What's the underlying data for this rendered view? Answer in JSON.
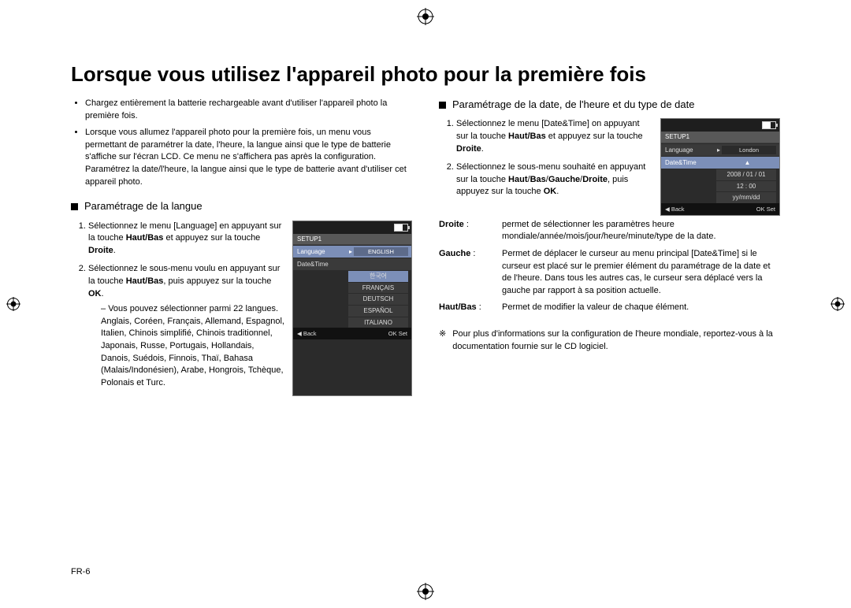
{
  "title": "Lorsque vous utilisez l'appareil photo pour la première fois",
  "col1": {
    "bullets": [
      "Chargez entièrement la batterie rechargeable avant d'utiliser l'appareil photo la première fois.",
      "Lorsque vous allumez l'appareil photo pour la première fois, un menu vous permettant de paramétrer la date, l'heure, la langue ainsi que le type de batterie s'affiche sur l'écran LCD. Ce menu ne s'affichera pas après la configuration. Paramétrez la date/l'heure, la langue ainsi que le type de batterie avant d'utiliser cet appareil photo."
    ],
    "section": "Paramétrage de la langue",
    "step1_pre": "Sélectionnez le menu [Language] en appuyant sur la touche ",
    "step1_bold1": "Haut/Bas",
    "step1_mid": " et appuyez sur la touche ",
    "step1_bold2": "Droite",
    "step1_post": ".",
    "step2_pre": "Sélectionnez le sous-menu voulu en appuyant sur la touche ",
    "step2_bold1": "Haut/Bas",
    "step2_mid": ", puis appuyez sur la touche ",
    "step2_bold2": "OK",
    "step2_post": ".",
    "sub": "Vous pouvez sélectionner parmi 22 langues. Anglais, Coréen, Français, Allemand, Espagnol, Italien, Chinois simplifié, Chinois traditionnel, Japonais, Russe, Portugais, Hollandais, Danois, Suédois, Finnois, Thaï, Bahasa (Malais/Indonésien), Arabe, Hongrois, Tchèque, Polonais et Turc.",
    "shot": {
      "tab": "SETUP1",
      "row1": {
        "label": "Language",
        "value": "ENGLISH",
        "sel": true
      },
      "row2": {
        "label": "Date&Time",
        "value": ""
      },
      "opts": [
        "한국어",
        "FRANÇAIS",
        "DEUTSCH",
        "ESPAÑOL",
        "ITALIANO"
      ],
      "back": "Back",
      "ok": "OK",
      "set": "Set"
    }
  },
  "col2": {
    "section": "Paramétrage de la date, de l'heure et du type de date",
    "step1_pre": "Sélectionnez le menu [Date&Time] on appuyant sur la touche ",
    "step1_bold1": "Haut/Bas",
    "step1_mid": " et appuyez sur la touche ",
    "step1_bold2": "Droite",
    "step1_post": ".",
    "step2_pre": "Sélectionnez le sous-menu souhaité en appuyant sur la touche ",
    "step2_bold1": "Haut",
    "step2_s1": "/",
    "step2_bold2": "Bas",
    "step2_s2": "/",
    "step2_bold3": "Gauche",
    "step2_s3": "/",
    "step2_bold4": "Droite",
    "step2_mid": ", puis appuyez sur la touche ",
    "step2_bold5": "OK",
    "step2_post": ".",
    "keys": {
      "droite_k": "Droite",
      "droite_v": "permet de sélectionner les paramètres heure mondiale/année/mois/jour/heure/minute/type de la date.",
      "gauche_k": "Gauche",
      "gauche_v": "Permet de déplacer le curseur au menu principal [Date&Time] si le curseur est placé sur le premier élément du paramétrage de la date et de l'heure. Dans tous les autres cas, le curseur sera déplacé vers la gauche par rapport à sa position actuelle.",
      "hb_k": "Haut/Bas",
      "hb_v": "Permet de modifier la valeur de chaque élément."
    },
    "star": "Pour plus d'informations sur la configuration de l'heure mondiale, reportez-vous à la documentation fournie sur le CD logiciel.",
    "shot": {
      "tab": "SETUP1",
      "row1": {
        "label": "Language",
        "value": "London"
      },
      "row2": {
        "label": "Date&Time",
        "sel": true
      },
      "vals": [
        "2008 / 01 / 01",
        "12 : 00",
        "yy/mm/dd"
      ],
      "back": "Back",
      "ok": "OK",
      "set": "Set"
    }
  },
  "pagenum": "FR-6"
}
